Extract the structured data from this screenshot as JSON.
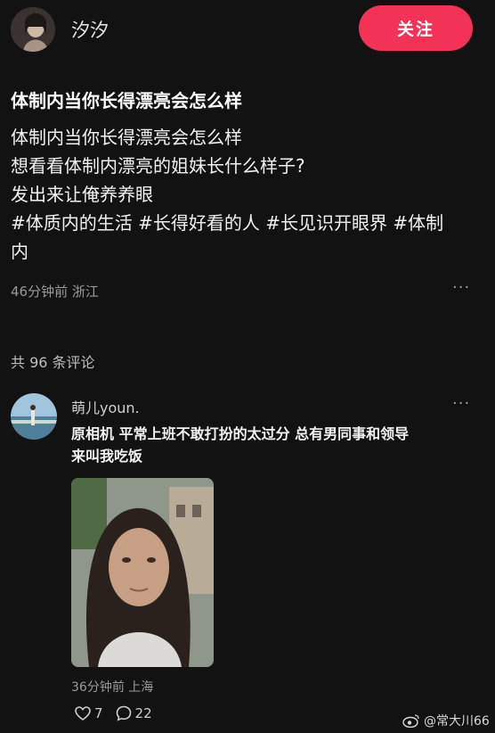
{
  "author": {
    "name": "汐汐"
  },
  "follow_label": "关注",
  "post": {
    "title": "体制内当你长得漂亮会怎么样",
    "lines": [
      "体制内当你长得漂亮会怎么样",
      "想看看体制内漂亮的姐妹长什么样子?",
      "发出来让俺养养眼"
    ],
    "tags_line1": "#体质内的生活 #长得好看的人 #长见识开眼界 #体制",
    "tags_line2": "内",
    "meta": "46分钟前 浙江"
  },
  "more_label": "···",
  "comments_count": "共 96 条评论",
  "comment": {
    "name": "萌儿youn.",
    "text_line1": "原相机 平常上班不敢打扮的太过分 总有男同事和领导",
    "text_line2": "来叫我吃饭",
    "meta": "36分钟前 上海",
    "likes": "7",
    "replies": "22"
  },
  "watermark": "@常大川66",
  "colors": {
    "background": "#121212",
    "follow": "#f23257"
  }
}
